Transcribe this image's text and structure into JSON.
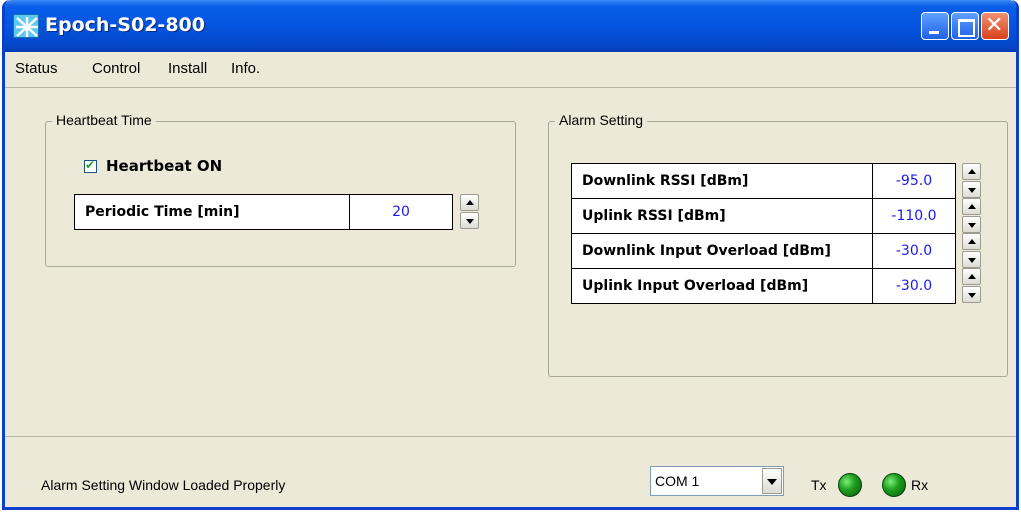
{
  "window": {
    "title": "Epoch-S02-800"
  },
  "menu": {
    "items": [
      "Status",
      "Control",
      "Install",
      "Info."
    ]
  },
  "heartbeat": {
    "group_label": "Heartbeat Time",
    "checkbox_label": "Heartbeat ON",
    "checked": true,
    "periodic_label": "Periodic Time [min]",
    "periodic_value": "20"
  },
  "alarm": {
    "group_label": "Alarm Setting",
    "rows": [
      {
        "label": "Downlink RSSI  [dBm]",
        "value": "-95.0"
      },
      {
        "label": "Uplink RSSI  [dBm]",
        "value": "-110.0"
      },
      {
        "label": "Downlink Input Overload [dBm]",
        "value": "-30.0"
      },
      {
        "label": "Uplink Input Overload [dBm]",
        "value": "-30.0"
      }
    ]
  },
  "status": {
    "message": "Alarm Setting Window Loaded Properly",
    "port": "COM 1",
    "tx_label": "Tx",
    "rx_label": "Rx"
  },
  "colors": {
    "value_text": "#1a1af0",
    "led_on": "#1fa01f",
    "titlebar": "#0554e0"
  }
}
